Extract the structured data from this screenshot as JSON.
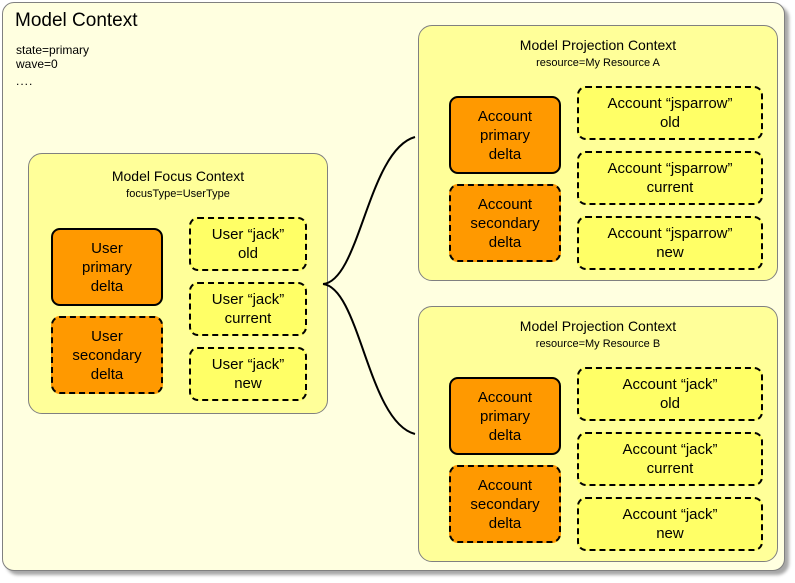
{
  "diagram": {
    "title": "Model Context",
    "properties": [
      "state=primary",
      "wave=0",
      "...."
    ]
  },
  "focus_context": {
    "title": "Model Focus Context",
    "subtitle": "focusType=UserType",
    "deltas": [
      {
        "line1": "User",
        "line2": "primary",
        "line3": "delta",
        "style": "solid"
      },
      {
        "line1": "User",
        "line2": "secondary",
        "line3": "delta",
        "style": "dashed"
      }
    ],
    "states": [
      {
        "line1": "User “jack”",
        "line2": "old"
      },
      {
        "line1": "User “jack”",
        "line2": "current"
      },
      {
        "line1": "User “jack”",
        "line2": "new"
      }
    ]
  },
  "projection_contexts": [
    {
      "title": "Model Projection Context",
      "subtitle": "resource=My Resource A",
      "deltas": [
        {
          "line1": "Account",
          "line2": "primary",
          "line3": "delta",
          "style": "solid"
        },
        {
          "line1": "Account",
          "line2": "secondary",
          "line3": "delta",
          "style": "dashed"
        }
      ],
      "states": [
        {
          "line1": "Account “jsparrow”",
          "line2": "old"
        },
        {
          "line1": "Account “jsparrow”",
          "line2": "current"
        },
        {
          "line1": "Account “jsparrow”",
          "line2": "new"
        }
      ]
    },
    {
      "title": "Model Projection Context",
      "subtitle": "resource=My Resource B",
      "deltas": [
        {
          "line1": "Account",
          "line2": "primary",
          "line3": "delta",
          "style": "solid"
        },
        {
          "line1": "Account",
          "line2": "secondary",
          "line3": "delta",
          "style": "dashed"
        }
      ],
      "states": [
        {
          "line1": "Account “jack”",
          "line2": "old"
        },
        {
          "line1": "Account “jack”",
          "line2": "current"
        },
        {
          "line1": "Account “jack”",
          "line2": "new"
        }
      ]
    }
  ],
  "colors": {
    "page_background": "#ffffff",
    "model_context_fill": "#ffffe0",
    "panel_fill": "#ffff99",
    "delta_fill": "#ff9900",
    "state_fill": "#ffff66",
    "panel_border": "#808080",
    "node_border": "#000000",
    "connector": "#000000"
  }
}
